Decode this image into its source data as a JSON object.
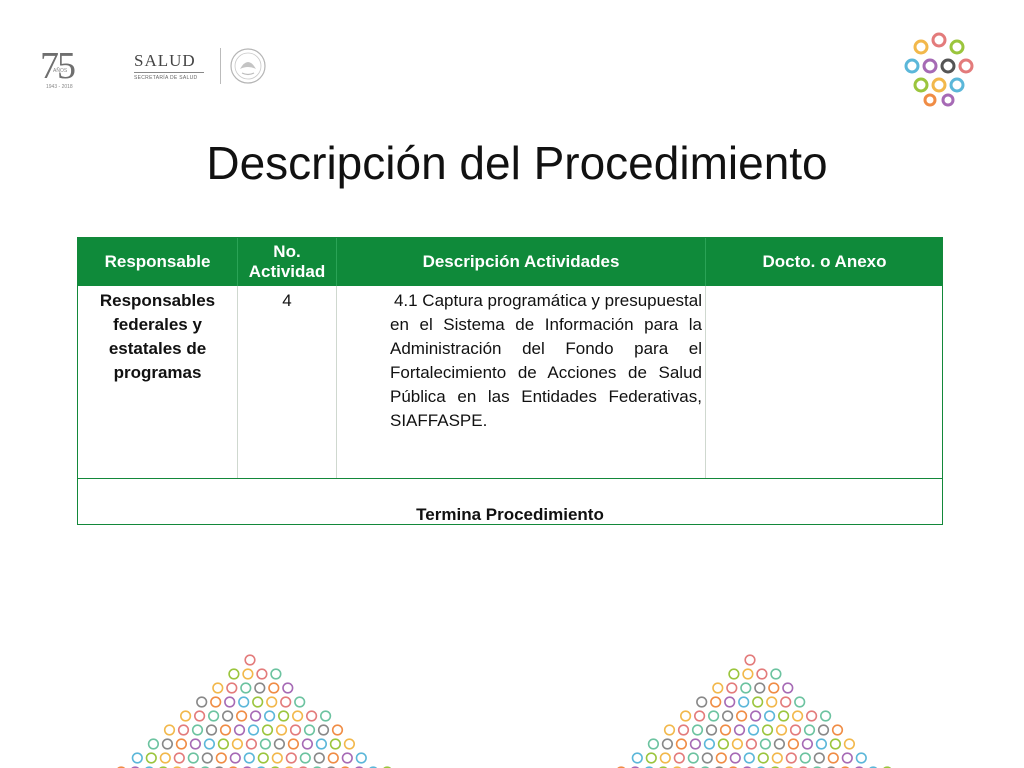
{
  "header": {
    "anniversary_number": "75",
    "anniversary_word": "AÑOS",
    "anniversary_years": "1943 - 2018",
    "ministry_name": "SALUD",
    "ministry_subtitle": "SECRETARÍA DE SALUD"
  },
  "title": "Descripción del Procedimiento",
  "table": {
    "headers": [
      "Responsable",
      "No. Actividad",
      "Descripción Actividades",
      "Docto. o Anexo"
    ],
    "rows": [
      {
        "responsable": "Responsables federales y estatales de programas",
        "numero": "4",
        "descripcion_first": "4.1 Captura programática y presupuestal",
        "descripcion_rest": "en el Sistema de Información para la Administración del Fondo para el Fortalecimiento de Acciones de Salud Pública en las Entidades Federativas, SIAFFASPE.",
        "anexo": ""
      }
    ],
    "footer": "Termina Procedimiento"
  },
  "colors": {
    "header_green": "#0f8a3a",
    "border_green": "#13883a"
  }
}
